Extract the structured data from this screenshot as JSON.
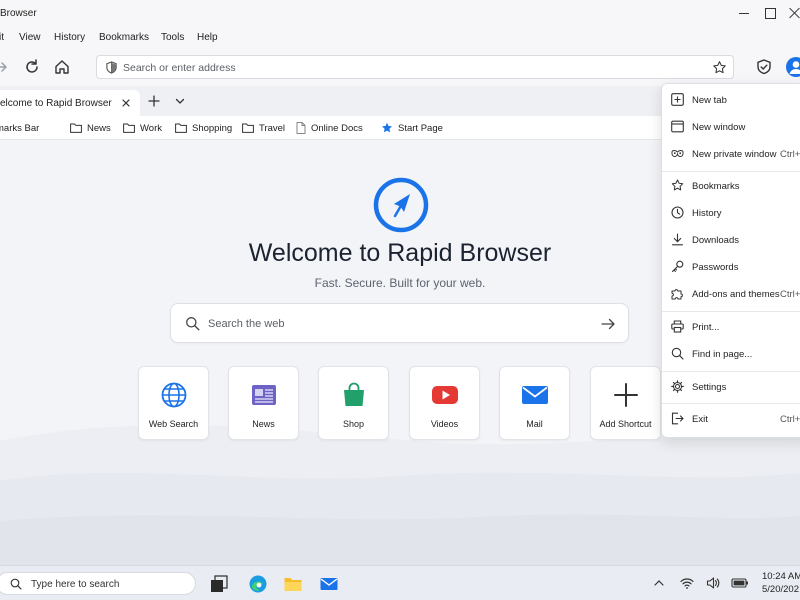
{
  "window": {
    "title": "Browser"
  },
  "menubar": {
    "items": [
      "it",
      "View",
      "History",
      "Bookmarks",
      "Tools",
      "Help"
    ]
  },
  "address_bar": {
    "placeholder": "Search or enter address"
  },
  "tabs": [
    {
      "title": "elcome to Rapid Browser"
    }
  ],
  "bookmarks": [
    {
      "label": "marks Bar",
      "icon": "none"
    },
    {
      "label": "News",
      "icon": "folder-icon"
    },
    {
      "label": "Work",
      "icon": "folder-icon"
    },
    {
      "label": "Shopping",
      "icon": "folder-icon"
    },
    {
      "label": "Travel",
      "icon": "folder-icon"
    },
    {
      "label": "Online Docs",
      "icon": "document-icon"
    },
    {
      "label": "Start Page",
      "icon": "star-icon"
    }
  ],
  "start_page": {
    "heading": "Welcome to Rapid Browser",
    "tagline": "Fast. Secure. Built for your web.",
    "search_placeholder": "Search the web",
    "shortcuts": [
      {
        "label": "Web Search",
        "icon": "globe-icon"
      },
      {
        "label": "News",
        "icon": "newspaper-icon"
      },
      {
        "label": "Shop",
        "icon": "shopping-bag-icon"
      },
      {
        "label": "Videos",
        "icon": "video-play-icon"
      },
      {
        "label": "Mail",
        "icon": "mail-icon"
      },
      {
        "label": "Add Shortcut",
        "icon": "plus-icon"
      }
    ]
  },
  "app_menu": {
    "items": [
      {
        "label": "New tab",
        "shortcut": "",
        "icon": "new-tab-icon"
      },
      {
        "label": "New window",
        "shortcut": "",
        "icon": "new-window-icon"
      },
      {
        "label": "New private window",
        "shortcut": "Ctrl+",
        "icon": "private-mask-icon"
      },
      {
        "label": "Bookmarks",
        "shortcut": "",
        "icon": "star-icon"
      },
      {
        "label": "History",
        "shortcut": "",
        "icon": "clock-icon"
      },
      {
        "label": "Downloads",
        "shortcut": "",
        "icon": "download-icon"
      },
      {
        "label": "Passwords",
        "shortcut": "",
        "icon": "key-icon"
      },
      {
        "label": "Add-ons and themes",
        "shortcut": "Ctrl+",
        "icon": "puzzle-icon"
      },
      {
        "label": "Print...",
        "shortcut": "",
        "icon": "printer-icon"
      },
      {
        "label": "Find in page...",
        "shortcut": "",
        "icon": "search-icon"
      },
      {
        "label": "Settings",
        "shortcut": "",
        "icon": "gear-icon"
      },
      {
        "label": "Exit",
        "shortcut": "Ctrl+",
        "icon": "exit-icon"
      }
    ]
  },
  "taskbar": {
    "search_placeholder": "Type here to search",
    "time": "10:24 AM",
    "date": "5/20/202"
  },
  "colors": {
    "accent": "#1a73e8",
    "page_background": "#f3f4f7",
    "heading_text": "#1b2230"
  }
}
